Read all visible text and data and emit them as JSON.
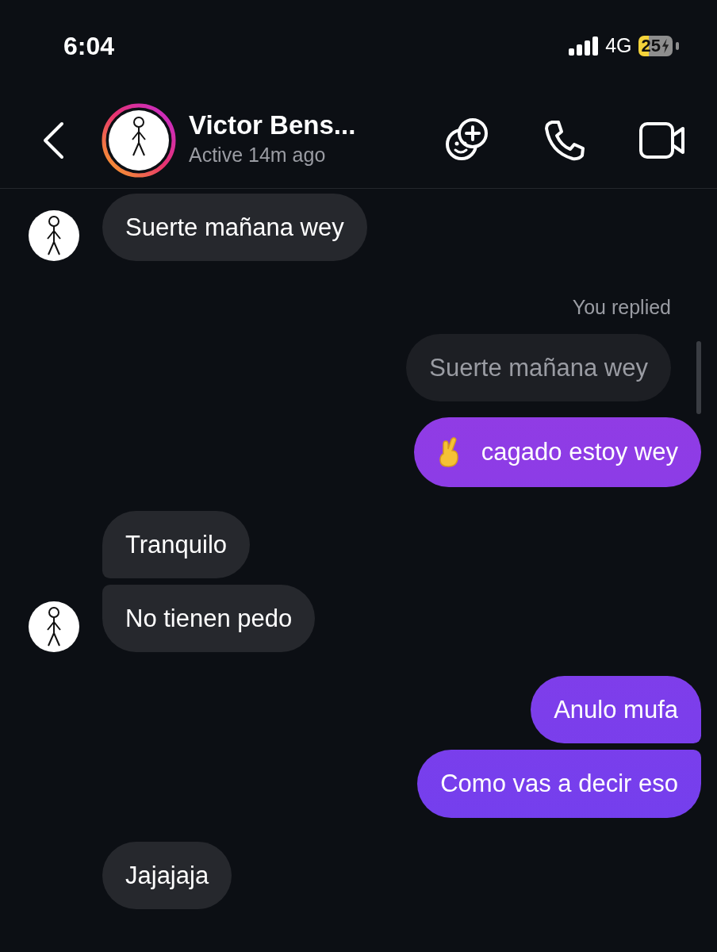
{
  "status_bar": {
    "time": "6:04",
    "network": "4G",
    "battery": "25"
  },
  "header": {
    "name": "Victor Bens...",
    "status": "Active 14m ago"
  },
  "messages": [
    {
      "kind": "incoming",
      "text": "Suerte mañana wey",
      "avatar": true
    },
    {
      "kind": "reply_label",
      "text": "You replied"
    },
    {
      "kind": "quoted",
      "text": "Suerte mañana wey"
    },
    {
      "kind": "outgoing",
      "text": "cagado estoy wey",
      "emoji_icon": true
    },
    {
      "kind": "incoming",
      "text": "Tranquilo",
      "avatar": false
    },
    {
      "kind": "incoming",
      "text": "No tienen pedo",
      "avatar": true
    },
    {
      "kind": "outgoing",
      "text": "Anulo mufa"
    },
    {
      "kind": "outgoing",
      "text": "Como vas a decir eso"
    },
    {
      "kind": "incoming",
      "text": "Jajajaja",
      "avatar": false
    }
  ]
}
